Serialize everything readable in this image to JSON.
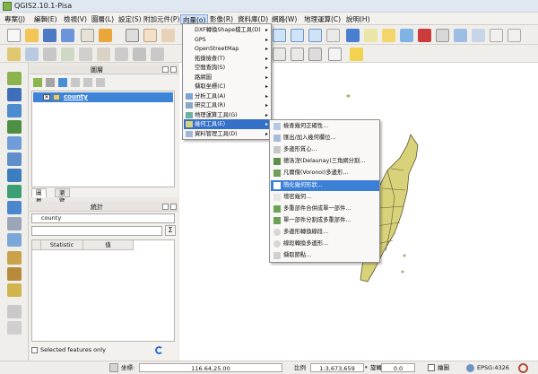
{
  "window": {
    "title": "QGIS2.10.1-Pisa"
  },
  "menubar": [
    "專案(J)",
    "編輯(E)",
    "檢視(V)",
    "圖層(L)",
    "設定(S)",
    "附加元件(P)",
    "向量(o)",
    "影像(R)",
    "資料庫(D)",
    "網路(W)",
    "地理運算(C)",
    "說明(H)"
  ],
  "analysis_menu": [
    {
      "label": "DXF轉換Shape檔工具(D)",
      "arrow": "▸"
    },
    {
      "label": "GPS",
      "arrow": "▸"
    },
    {
      "label": "OpenStreetMap",
      "arrow": "▸"
    },
    {
      "label": "拓撲檢查(T)",
      "arrow": "▸"
    },
    {
      "label": "空間查詢(S)",
      "arrow": "▸"
    },
    {
      "label": "路網圖",
      "arrow": "▸"
    },
    {
      "label": "擷取坐標(C)",
      "arrow": "▸"
    },
    {
      "label": "分析工具(A)",
      "arrow": "▸"
    },
    {
      "label": "研究工具(R)",
      "arrow": "▸"
    },
    {
      "label": "地理運算工具(G)",
      "arrow": "▸"
    },
    {
      "label": "幾何工具(E)",
      "arrow": "▸"
    },
    {
      "label": "資料管理工具(D)",
      "arrow": "▸"
    }
  ],
  "geometry_submenu": [
    "檢查幾何正確性...",
    "匯出/加入幾何欄位...",
    "多邊形質心...",
    "德洛涅(Delaunay)三角網分割...",
    "凡爾傑(Voronoi)多邊形...",
    "簡化幾何形狀...",
    "增密幾何...",
    "多重部件合併成單一部件...",
    "單一部件分割成多重部件...",
    "多邊形轉換線段...",
    "線段轉換多邊形...",
    "擷取節點..."
  ],
  "layers_panel": {
    "title": "圖層",
    "layer_name": "county",
    "checked": "✕",
    "tabs": [
      "圖層",
      "瀏覽器"
    ],
    "layer_color": "#d8d27a"
  },
  "stats_panel": {
    "title": "統計",
    "layer": "county",
    "sigma": "Σ",
    "columns": [
      "Statistic",
      "值"
    ],
    "selected_only": "Selected features only"
  },
  "status": {
    "coord_label": "坐標:",
    "coord_value": "116.64,25.00",
    "scale_label": "比例",
    "scale_value": "1:3,673,659",
    "rotation_label": "旋轉:",
    "rotation_value": "0.0",
    "render_label": "繪圖",
    "crs": "EPSG:4326"
  },
  "colors": {
    "selection_blue": "#3470c7",
    "polygon_fill": "#d8d27a",
    "polygon_stroke": "#5a5630"
  }
}
